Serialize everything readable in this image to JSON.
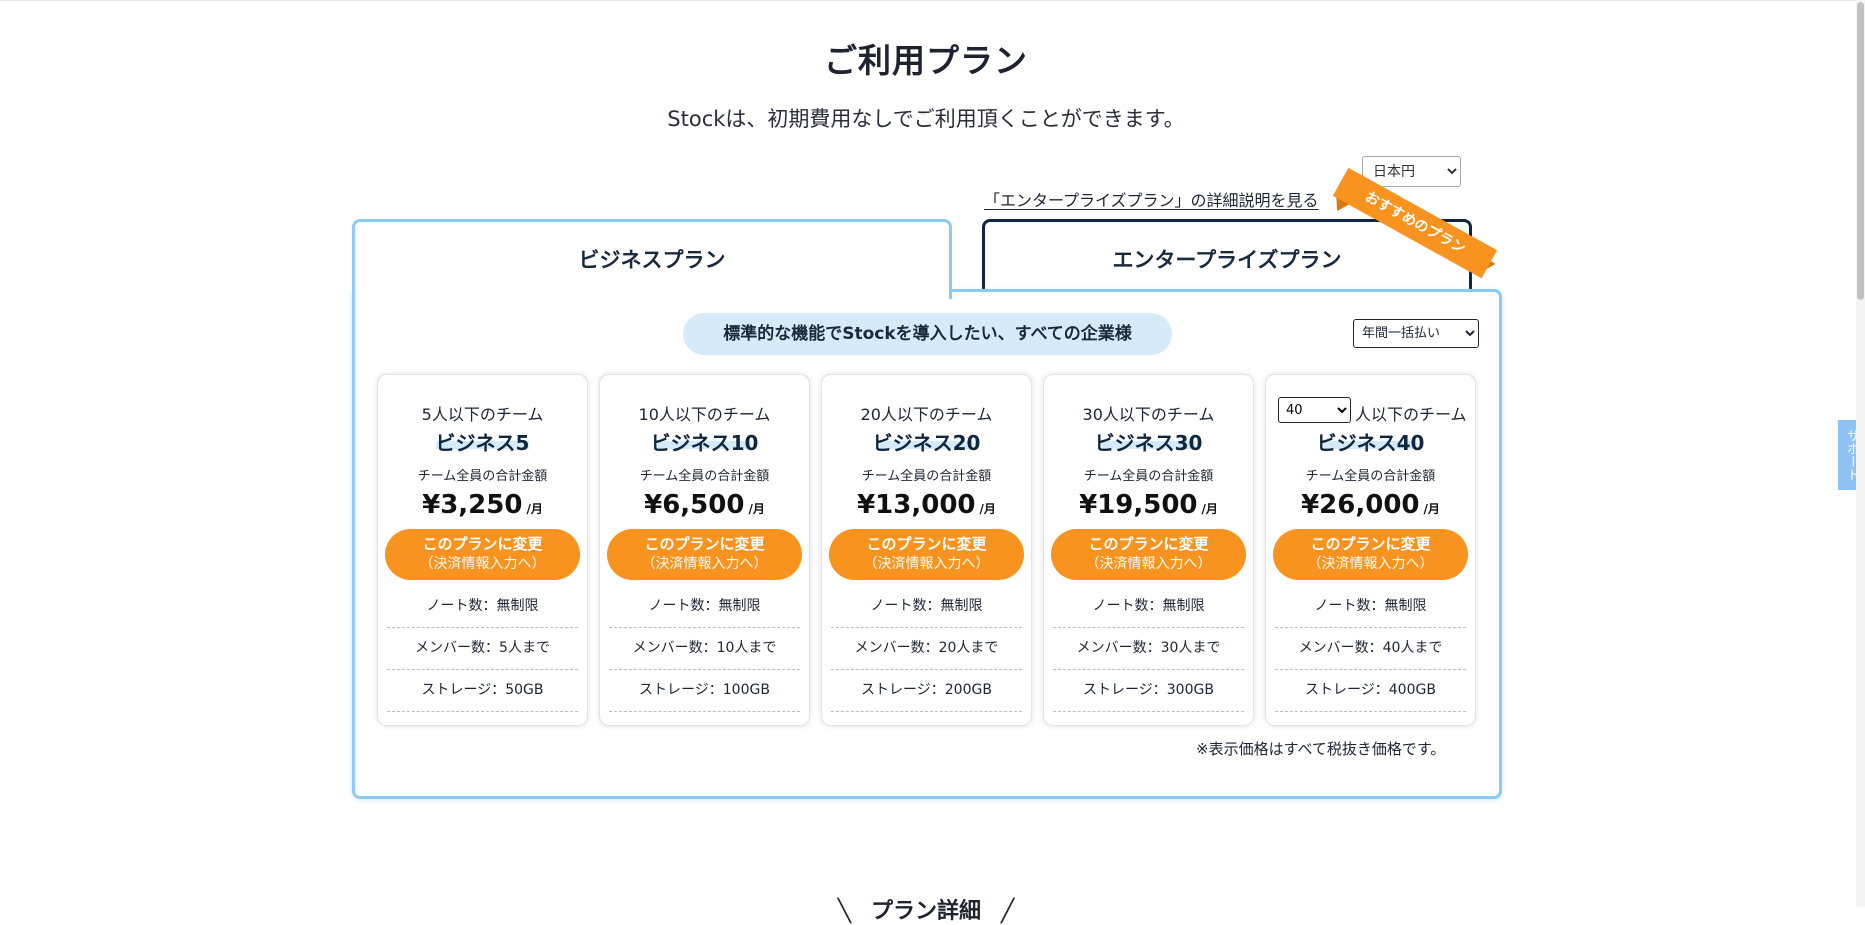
{
  "header": {
    "title": "ご利用プラン",
    "subtitle": "Stockは、初期費用なしでご利用頂くことができます。"
  },
  "currency": {
    "selected": "日本円"
  },
  "enterprise_link": "「エンタープライズプラン」の詳細説明を見る",
  "tabs": [
    {
      "label": "ビジネスプラン",
      "active": true
    },
    {
      "label": "エンタープライズプラン",
      "active": false
    }
  ],
  "ribbon": "おすすめのプラン",
  "panel": {
    "audience": "標準的な機能でStockを導入したい、すべての企業様",
    "billing": {
      "selected": "年間一括払い"
    },
    "plans": [
      {
        "team": "5人以下のチーム",
        "name": "ビジネス5",
        "total_label": "チーム全員の合計金額",
        "price": "¥3,250",
        "per": "/月",
        "cta_line1": "このプランに変更",
        "cta_line2": "（決済情報入力へ）",
        "features": [
          "ノート数：無制限",
          "メンバー数：5人まで",
          "ストレージ：50GB"
        ]
      },
      {
        "team": "10人以下のチーム",
        "name": "ビジネス10",
        "total_label": "チーム全員の合計金額",
        "price": "¥6,500",
        "per": "/月",
        "cta_line1": "このプランに変更",
        "cta_line2": "（決済情報入力へ）",
        "features": [
          "ノート数：無制限",
          "メンバー数：10人まで",
          "ストレージ：100GB"
        ]
      },
      {
        "team": "20人以下のチーム",
        "name": "ビジネス20",
        "total_label": "チーム全員の合計金額",
        "price": "¥13,000",
        "per": "/月",
        "cta_line1": "このプランに変更",
        "cta_line2": "（決済情報入力へ）",
        "features": [
          "ノート数：無制限",
          "メンバー数：20人まで",
          "ストレージ：200GB"
        ]
      },
      {
        "team": "30人以下のチーム",
        "name": "ビジネス30",
        "total_label": "チーム全員の合計金額",
        "price": "¥19,500",
        "per": "/月",
        "cta_line1": "このプランに変更",
        "cta_line2": "（決済情報入力へ）",
        "features": [
          "ノート数：無制限",
          "メンバー数：30人まで",
          "ストレージ：300GB"
        ]
      },
      {
        "team_select": "40",
        "team_suffix": "人以下のチーム",
        "name": "ビジネス40",
        "total_label": "チーム全員の合計金額",
        "price": "¥26,000",
        "per": "/月",
        "cta_line1": "このプランに変更",
        "cta_line2": "（決済情報入力へ）",
        "features": [
          "ノート数：無制限",
          "メンバー数：40人まで",
          "ストレージ：400GB"
        ]
      }
    ],
    "tax_note": "※表示価格はすべて税抜き価格です。"
  },
  "support_tab": "サポート",
  "bottom_heading": "プラン詳細",
  "colors": {
    "accent_blue": "#8ccbf2",
    "cta_orange": "#f7931e",
    "navy": "#0e2740",
    "pill_blue": "#d6ebfa"
  }
}
